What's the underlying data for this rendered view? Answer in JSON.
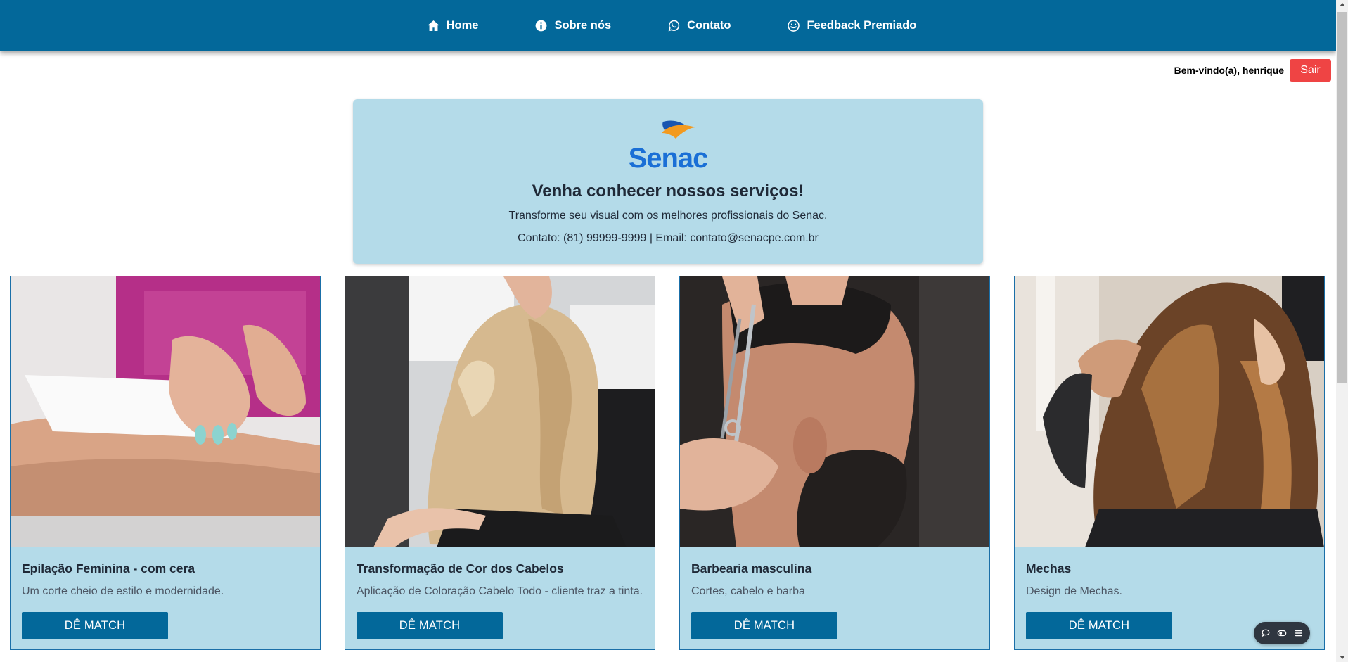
{
  "nav": {
    "items": [
      {
        "label": "Home",
        "icon": "home-icon"
      },
      {
        "label": "Sobre nós",
        "icon": "info-icon"
      },
      {
        "label": "Contato",
        "icon": "whatsapp-icon"
      },
      {
        "label": "Feedback Premiado",
        "icon": "smile-icon"
      }
    ]
  },
  "user": {
    "welcome": "Bem-vindo(a), henrique",
    "logout_label": "Sair"
  },
  "hero": {
    "logo_text": "Senac",
    "title": "Venha conhecer nossos serviços!",
    "subtitle": "Transforme seu visual com os melhores profissionais do Senac.",
    "contact": "Contato: (81) 99999-9999 | Email: contato@senacpe.com.br"
  },
  "services": [
    {
      "title": "Epilação Feminina - com cera",
      "description": "Um corte cheio de estilo e modernidade.",
      "button": "DÊ MATCH"
    },
    {
      "title": "Transformação de Cor dos Cabelos",
      "description": "Aplicação de Coloração Cabelo Todo - cliente traz a tinta.",
      "button": "DÊ MATCH"
    },
    {
      "title": "Barbearia masculina",
      "description": "Cortes, cabelo e barba",
      "button": "DÊ MATCH"
    },
    {
      "title": "Mechas",
      "description": "Design de Mechas.",
      "button": "DÊ MATCH"
    }
  ],
  "colors": {
    "navbar": "#03689a",
    "card_bg": "#b4dbe9",
    "button": "#03689a",
    "logout": "#ef4444"
  }
}
